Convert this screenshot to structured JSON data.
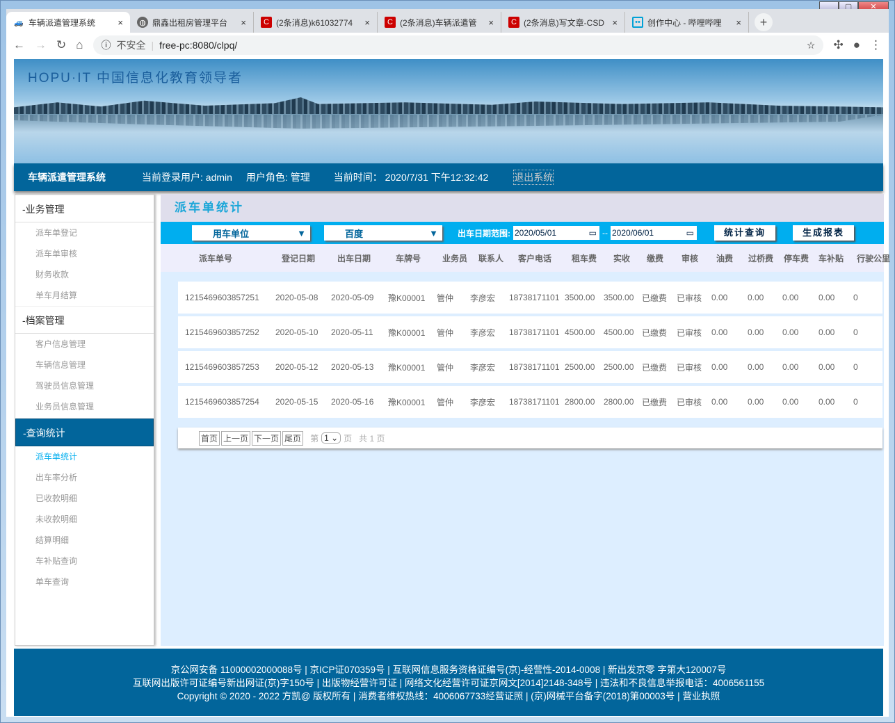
{
  "browser": {
    "tabs": [
      {
        "label": "车辆派遣管理系统",
        "active": true
      },
      {
        "label": "鼎鑫出租房管理平台"
      },
      {
        "label": "(2条消息)k61032774"
      },
      {
        "label": "(2条消息)车辆派遣管"
      },
      {
        "label": "(2条消息)写文章-CSD"
      },
      {
        "label": "创作中心 - 哔哩哔哩"
      }
    ],
    "close": "×",
    "new_tab": "+",
    "security": "不安全",
    "url": "free-pc:8080/clpq/"
  },
  "banner": {
    "title": "HOPU·IT 中国信息化教育领导者"
  },
  "nav": {
    "system": "车辆派遣管理系统",
    "user": "当前登录用户: admin",
    "role": "用户角色: 管理",
    "time": "当前时间： 2020/7/31 下午12:32:42",
    "logout": "退出系统"
  },
  "sidebar": [
    {
      "group": "-业务管理",
      "items": [
        "派车单登记",
        "派车单审核",
        "财务收款",
        "单车月结算"
      ]
    },
    {
      "group": "-档案管理",
      "items": [
        "客户信息管理",
        "车辆信息管理",
        "驾驶员信息管理",
        "业务员信息管理"
      ]
    },
    {
      "group": "-查询统计",
      "active": true,
      "items": [
        "派车单统计",
        "出车率分析",
        "已收款明细",
        "未收款明细",
        "结算明细",
        "车补贴查询",
        "单车查询"
      ]
    }
  ],
  "main": {
    "title": "派车单统计",
    "filter": {
      "unit_select": "用车单位",
      "unit_value": "百度",
      "date_label": "出车日期范围:",
      "date_from": "2020/05/01",
      "sep": "--",
      "date_to": "2020/06/01",
      "query": "统计查询",
      "report": "生成报表"
    },
    "headers": [
      "派车单号",
      "登记日期",
      "出车日期",
      "车牌号",
      "业务员",
      "联系人",
      "客户电话",
      "租车费",
      "实收",
      "缴费",
      "审核",
      "油费",
      "过桥费",
      "停车费",
      "车补贴",
      "行驶公里"
    ],
    "rows": [
      [
        "1215469603857251",
        "2020-05-08",
        "2020-05-09",
        "豫K00001",
        "管仲",
        "李彦宏",
        "18738171101",
        "3500.00",
        "3500.00",
        "已缴费",
        "已审核",
        "0.00",
        "0.00",
        "0.00",
        "0.00",
        "0"
      ],
      [
        "1215469603857252",
        "2020-05-10",
        "2020-05-11",
        "豫K00001",
        "管仲",
        "李彦宏",
        "18738171101",
        "4500.00",
        "4500.00",
        "已缴费",
        "已审核",
        "0.00",
        "0.00",
        "0.00",
        "0.00",
        "0"
      ],
      [
        "1215469603857253",
        "2020-05-12",
        "2020-05-13",
        "豫K00001",
        "管仲",
        "李彦宏",
        "18738171101",
        "2500.00",
        "2500.00",
        "已缴费",
        "已审核",
        "0.00",
        "0.00",
        "0.00",
        "0.00",
        "0"
      ],
      [
        "1215469603857254",
        "2020-05-15",
        "2020-05-16",
        "豫K00001",
        "管仲",
        "李彦宏",
        "18738171101",
        "2800.00",
        "2800.00",
        "已缴费",
        "已审核",
        "0.00",
        "0.00",
        "0.00",
        "0.00",
        "0"
      ]
    ],
    "pager": {
      "first": "首页",
      "prev": "上一页",
      "next": "下一页",
      "last": "尾页",
      "page_prefix": "第",
      "page": "1",
      "page_suffix": "页",
      "total": "共 1 页"
    }
  },
  "footer": [
    "京公网安备 11000002000088号 | 京ICP证070359号 | 互联网信息服务资格证编号(京)-经营性-2014-0008 | 新出发京零 字第大120007号",
    "互联网出版许可证编号新出网证(京)字150号 | 出版物经营许可证 | 网络文化经营许可证京网文[2014]2148-348号 | 违法和不良信息举报电话：4006561155",
    "Copyright © 2020 - 2022 方凯@ 版权所有 | 消费者维权热线：4006067733经营证照 | (京)网械平台备字(2018)第00003号 | 营业执照"
  ]
}
